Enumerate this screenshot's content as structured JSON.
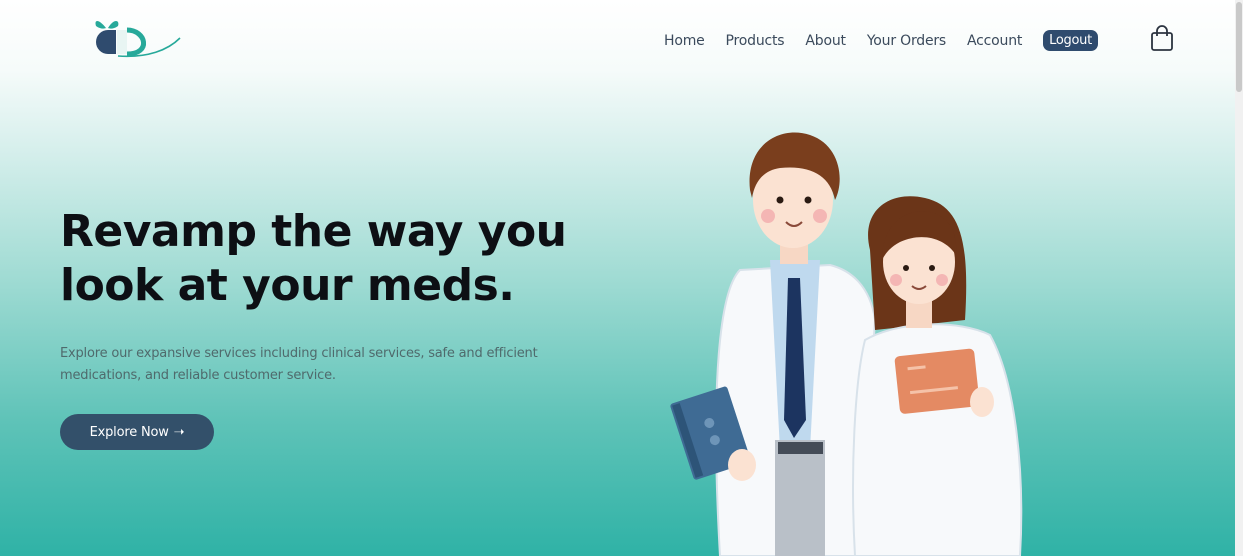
{
  "header": {
    "logo_icon": "pharmacy-logo-icon",
    "nav": [
      {
        "label": "Home"
      },
      {
        "label": "Products"
      },
      {
        "label": "About"
      },
      {
        "label": "Your Orders"
      },
      {
        "label": "Account"
      }
    ],
    "logout_label": "Logout",
    "cart_icon": "shopping-bag-icon"
  },
  "hero": {
    "headline_line1": "Revamp the way you",
    "headline_line2": "look at your meds.",
    "subtext": "Explore our expansive services including clinical services, safe and efficient medications, and reliable customer service.",
    "cta_label": "Explore Now",
    "cta_arrow": "➝",
    "illustration": "doctors-illustration"
  },
  "colors": {
    "brand_dark": "#2f4b6e",
    "brand_teal": "#2fb2a6",
    "headline": "#0d0f14"
  }
}
